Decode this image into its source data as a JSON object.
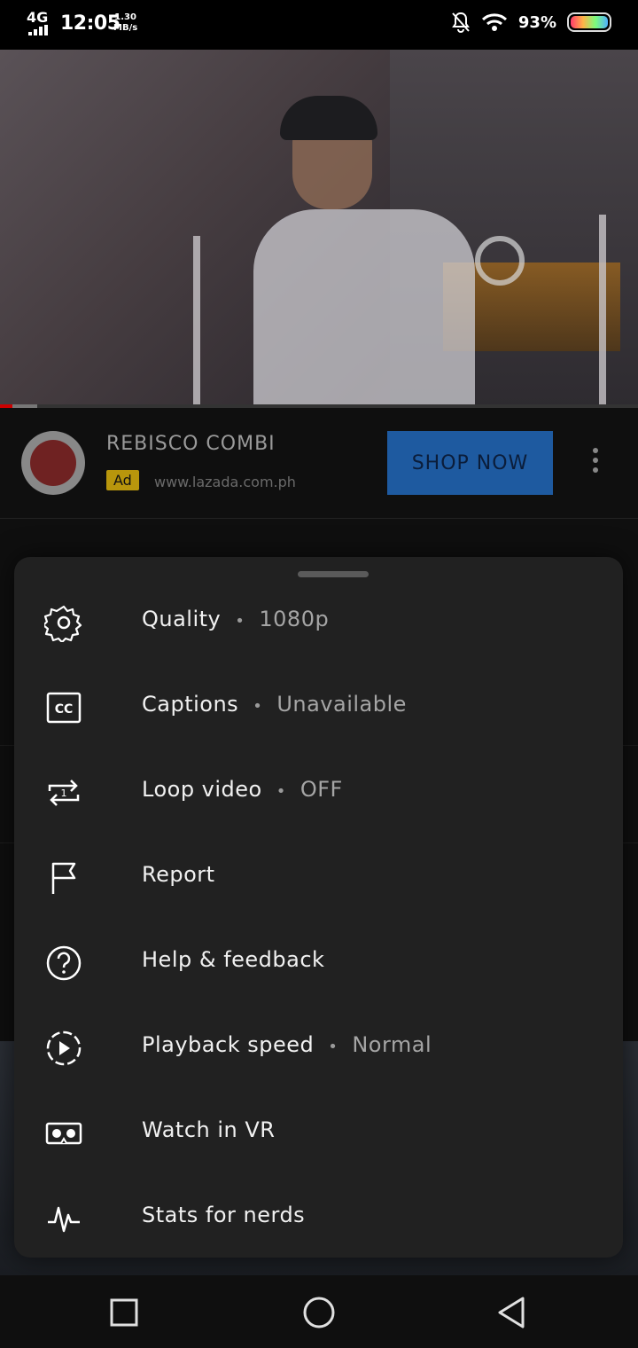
{
  "status_bar": {
    "network": "4G",
    "time": "12:05",
    "speed_value": "1.30",
    "speed_unit": "MB/s",
    "battery": "93%"
  },
  "ad": {
    "title": "REBISCO COMBI",
    "badge": "Ad",
    "url": "www.lazada.com.ph",
    "cta": "SHOP NOW"
  },
  "menu": {
    "items": [
      {
        "label": "Quality",
        "value": "1080p",
        "icon": "gear-icon"
      },
      {
        "label": "Captions",
        "value": "Unavailable",
        "icon": "captions-icon"
      },
      {
        "label": "Loop video",
        "value": "OFF",
        "icon": "loop-icon"
      },
      {
        "label": "Report",
        "value": "",
        "icon": "flag-icon"
      },
      {
        "label": "Help & feedback",
        "value": "",
        "icon": "help-icon"
      },
      {
        "label": "Playback speed",
        "value": "Normal",
        "icon": "playback-speed-icon"
      },
      {
        "label": "Watch in VR",
        "value": "",
        "icon": "vr-icon"
      },
      {
        "label": "Stats for nerds",
        "value": "",
        "icon": "stats-icon"
      }
    ]
  },
  "progress": {
    "played_fraction": 0.02
  }
}
